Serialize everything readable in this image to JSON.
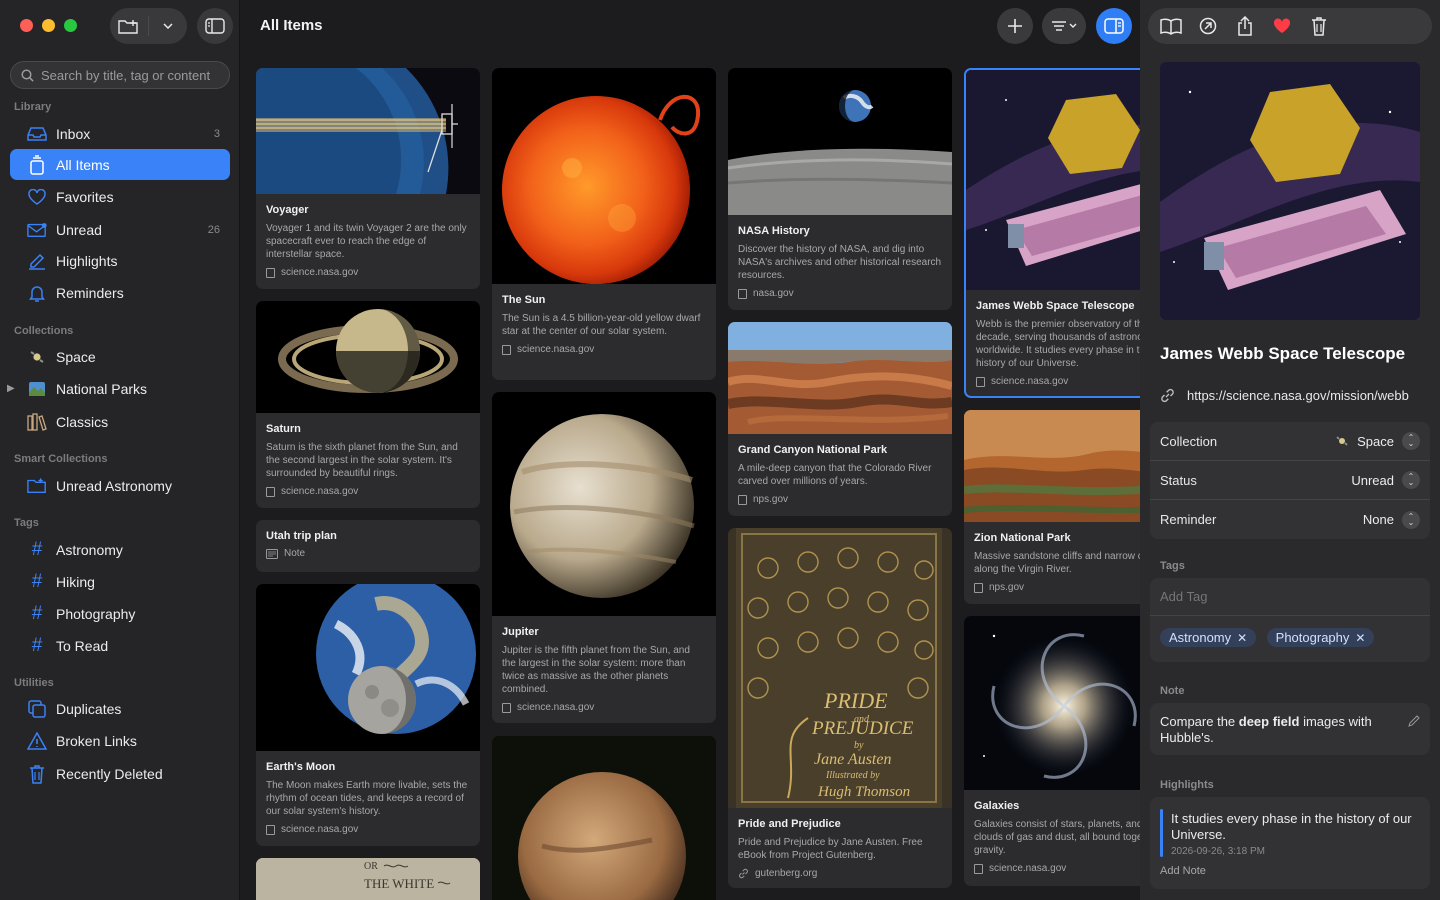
{
  "header": {
    "title": "All Items"
  },
  "search": {
    "placeholder": "Search by title, tag or content"
  },
  "sidebar": {
    "library_label": "Library",
    "library": [
      {
        "label": "Inbox",
        "count": "3",
        "icon": "tray-icon"
      },
      {
        "label": "All Items",
        "count": "",
        "icon": "stack-icon"
      },
      {
        "label": "Favorites",
        "count": "",
        "icon": "heart-icon"
      },
      {
        "label": "Unread",
        "count": "26",
        "icon": "envelope-icon"
      },
      {
        "label": "Highlights",
        "count": "",
        "icon": "highlighter-icon"
      },
      {
        "label": "Reminders",
        "count": "",
        "icon": "bell-icon"
      }
    ],
    "collections_label": "Collections",
    "collections": [
      {
        "label": "Space",
        "icon": "satellite-icon"
      },
      {
        "label": "National Parks",
        "icon": "landscape-icon"
      },
      {
        "label": "Classics",
        "icon": "books-icon"
      }
    ],
    "smart_label": "Smart Collections",
    "smart": [
      {
        "label": "Unread Astronomy",
        "icon": "smart-folder-icon"
      }
    ],
    "tags_label": "Tags",
    "tags": [
      {
        "label": "Astronomy"
      },
      {
        "label": "Hiking"
      },
      {
        "label": "Photography"
      },
      {
        "label": "To Read"
      }
    ],
    "utilities_label": "Utilities",
    "utilities": [
      {
        "label": "Duplicates",
        "icon": "duplicate-icon"
      },
      {
        "label": "Broken Links",
        "icon": "warning-icon"
      },
      {
        "label": "Recently Deleted",
        "icon": "trash-icon"
      }
    ]
  },
  "cards": {
    "voyager": {
      "title": "Voyager",
      "desc": "Voyager 1 and its twin Voyager 2 are the only spacecraft ever to reach the edge of interstellar space.",
      "source": "science.nasa.gov"
    },
    "saturn": {
      "title": "Saturn",
      "desc": "Saturn is the sixth planet from the Sun, and the second largest in the solar system. It's surrounded by beautiful rings.",
      "source": "science.nasa.gov"
    },
    "utah": {
      "title": "Utah trip plan",
      "source": "Note"
    },
    "moon": {
      "title": "Earth's Moon",
      "desc": "The Moon makes Earth more livable, sets the rhythm of ocean tides, and keeps a record of our solar system's history.",
      "source": "science.nasa.gov"
    },
    "whitewhale": {
      "thumb_text_1": "OR",
      "thumb_text_2": "THE WHITE"
    },
    "sun": {
      "title": "The Sun",
      "desc": "The Sun is a 4.5 billion-year-old yellow dwarf star at the center of our solar system.",
      "source": "science.nasa.gov"
    },
    "jupiter": {
      "title": "Jupiter",
      "desc": "Jupiter is the fifth planet from the Sun, and the largest in the solar system: more than twice as massive as the other planets combined.",
      "source": "science.nasa.gov"
    },
    "nasa": {
      "title": "NASA History",
      "desc": "Discover the history of NASA, and dig into NASA's archives and other historical research resources.",
      "source": "nasa.gov"
    },
    "canyon": {
      "title": "Grand Canyon National Park",
      "desc": "A mile-deep canyon that the Colorado River carved over millions of years.",
      "source": "nps.gov"
    },
    "pride": {
      "title": "Pride and Prejudice",
      "desc": "Pride and Prejudice by Jane Austen. Free eBook from Project Gutenberg.",
      "source": "gutenberg.org",
      "cover_1": "PRIDE",
      "cover_2": "and",
      "cover_3": "PREJUDICE",
      "cover_4": "by",
      "cover_5": "Jane Austen",
      "cover_6": "Illustrated by",
      "cover_7": "Hugh Thomson"
    },
    "jwst": {
      "title": "James Webb Space Telescope",
      "desc": "Webb is the premier observatory of the next decade, serving thousands of astronomers worldwide. It studies every phase in the history of our Universe.",
      "source": "science.nasa.gov"
    },
    "zion": {
      "title": "Zion National Park",
      "desc": "Massive sandstone cliffs and narrow canyons along the Virgin River.",
      "source": "nps.gov"
    },
    "galaxies": {
      "title": "Galaxies",
      "desc": "Galaxies consist of stars, planets, and vast clouds of gas and dust, all bound together by gravity.",
      "source": "science.nasa.gov"
    }
  },
  "inspector": {
    "title": "James Webb Space Telescope",
    "url": "https://science.nasa.gov/mission/webb",
    "collection_label": "Collection",
    "collection_value": "Space",
    "status_label": "Status",
    "status_value": "Unread",
    "reminder_label": "Reminder",
    "reminder_value": "None",
    "tags_label": "Tags",
    "add_tag_placeholder": "Add Tag",
    "tags": [
      "Astronomy",
      "Photography"
    ],
    "note_label": "Note",
    "note_pre": "Compare the ",
    "note_bold": "deep field",
    "note_post": " images with Hubble's.",
    "highlights_label": "Highlights",
    "highlight_text": "It studies every phase in the history of our Universe.",
    "highlight_date": "2026-09-26, 3:18 PM",
    "add_note": "Add Note"
  },
  "colors": {
    "accent": "#3a82f7",
    "favorite": "#ff3b45"
  }
}
